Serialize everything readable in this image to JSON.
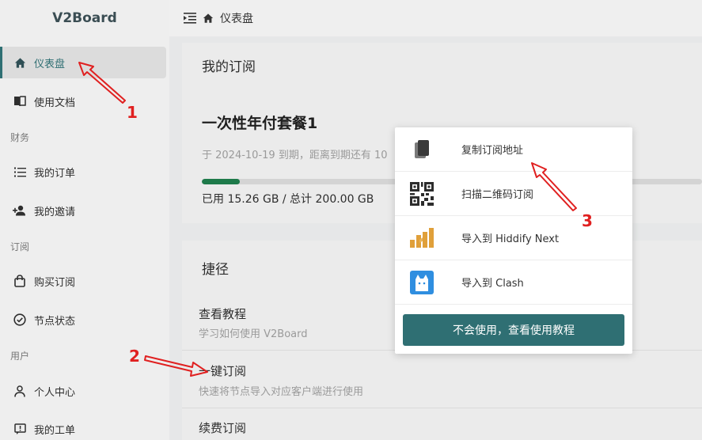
{
  "brand": "V2Board",
  "header": {
    "breadcrumb": "仪表盘"
  },
  "sidebar": {
    "items": [
      {
        "label": "仪表盘",
        "icon": "home-icon"
      },
      {
        "label": "使用文档",
        "icon": "book-icon"
      },
      {
        "label": "我的订单",
        "icon": "list-icon"
      },
      {
        "label": "我的邀请",
        "icon": "user-plus-icon"
      },
      {
        "label": "购买订阅",
        "icon": "bag-icon"
      },
      {
        "label": "节点状态",
        "icon": "check-circle-icon"
      },
      {
        "label": "个人中心",
        "icon": "user-icon"
      },
      {
        "label": "我的工单",
        "icon": "ticket-icon"
      }
    ],
    "sections": [
      "财务",
      "订阅",
      "用户"
    ]
  },
  "subscription": {
    "title": "我的订阅",
    "plan": "一次性年付套餐1",
    "expire_text": "于 2024-10-19 到期，距离到期还有 10",
    "usage_text": "已用 15.26 GB / 总计 200.00 GB",
    "used_fraction": 0.0763
  },
  "shortcuts": {
    "title": "捷径",
    "items": [
      {
        "title": "查看教程",
        "desc": "学习如何使用 V2Board"
      },
      {
        "title": "一键订阅",
        "desc": "快速将节点导入对应客户端进行使用"
      },
      {
        "title": "续费订阅",
        "desc": ""
      }
    ]
  },
  "popup": {
    "items": [
      {
        "label": "复制订阅地址",
        "icon": "copy-icon"
      },
      {
        "label": "扫描二维码订阅",
        "icon": "qr-code-icon"
      },
      {
        "label": "导入到 Hiddify Next",
        "icon": "hiddify-icon"
      },
      {
        "label": "导入到 Clash",
        "icon": "clash-cat-icon"
      }
    ],
    "button": "不会使用，查看使用教程"
  },
  "annotations": [
    "1",
    "2",
    "3"
  ],
  "colors": {
    "accent": "#2f6f73",
    "progress": "#1e7a4a",
    "annotation": "#e02020"
  }
}
